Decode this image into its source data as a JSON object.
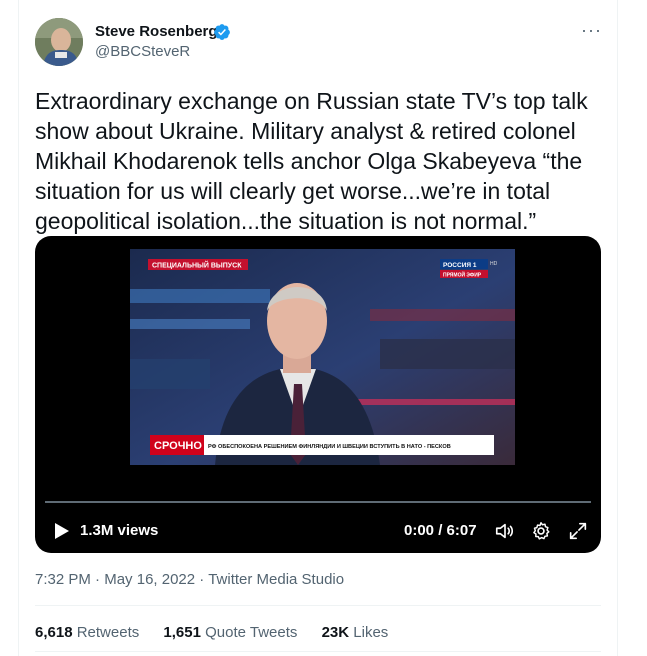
{
  "author": {
    "display_name": "Steve Rosenberg",
    "handle": "@BBCSteveR"
  },
  "more_menu": "···",
  "tweet": {
    "text": "Extraordinary exchange on Russian state TV’s top talk show about Ukraine. Military analyst & retired colonel Mikhail Khodarenok tells anchor Olga Skabeyeva “the situation for us will clearly get worse...we’re in total geopolitical isolation...the situation is not normal.”"
  },
  "video": {
    "views": "1.3M views",
    "time": "0:00 / 6:07",
    "progress_fraction": 0,
    "frame": {
      "special_banner": "СПЕЦИАЛЬНЫЙ ВЫПУСК",
      "channel_logo": "РОССИЯ 1",
      "channel_hd": "HD",
      "live_label": "ПРЯМОЙ ЭФИР",
      "urgent_label": "СРОЧНО",
      "ticker": "РФ ОБЕСПОКОЕНА РЕШЕНИЕМ ФИНЛЯНДИИ И ШВЕЦИИ ВСТУПИТЬ В НАТО - ПЕСКОВ"
    }
  },
  "meta": {
    "time": "7:32 PM",
    "sep1": " · ",
    "date": "May 16, 2022",
    "sep2": " · ",
    "source": "Twitter Media Studio"
  },
  "stats": {
    "retweets_count": "6,618",
    "retweets_label": " Retweets",
    "quotes_count": "1,651",
    "quotes_label": " Quote Tweets",
    "likes_count": "23K",
    "likes_label": " Likes"
  },
  "colors": {
    "verified": "#1d9bf0",
    "muted_text": "#536471",
    "main_text": "#0f1419",
    "urgent_red": "#d0021b"
  }
}
